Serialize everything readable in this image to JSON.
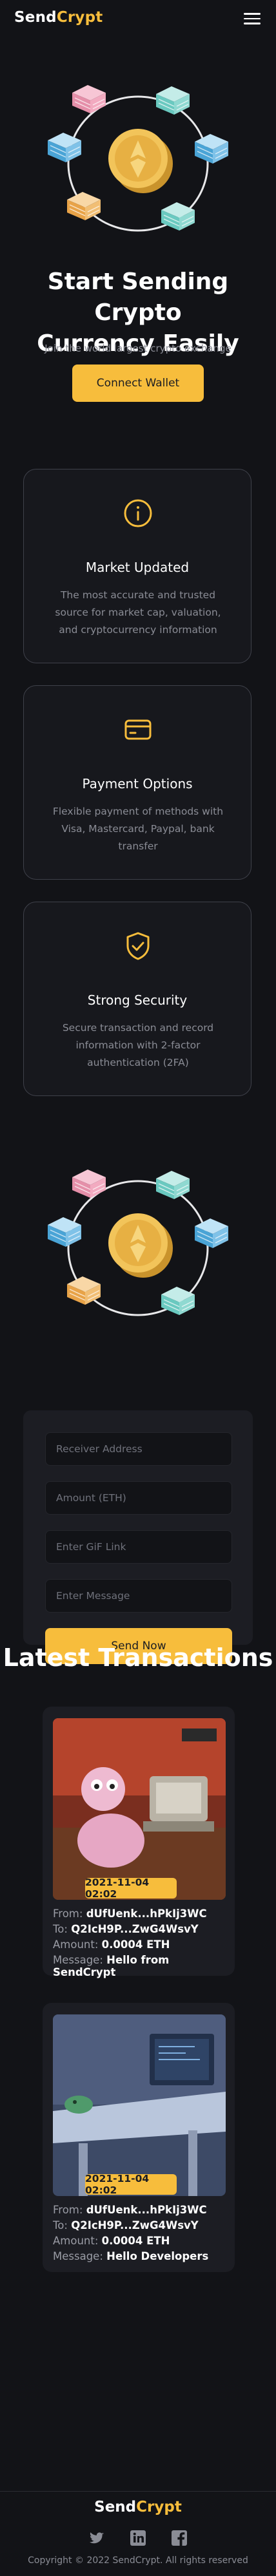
{
  "header": {
    "logo_part1": "Send",
    "logo_part2": "Crypt",
    "menu_icon": "hamburger-menu-icon"
  },
  "hero": {
    "title_line1": "Start Sending Crypto",
    "title_line2": "Currency Easily",
    "subtitle": "Join the world largest crypto exchange",
    "connect_button": "Connect Wallet",
    "illustration": "crypto-coin-network-illustration"
  },
  "features": [
    {
      "icon": "info-circle-icon",
      "title": "Market Updated",
      "description": "The most accurate and trusted source for market cap, valuation, and cryptocurrency information"
    },
    {
      "icon": "credit-card-icon",
      "title": "Payment Options",
      "description": "Flexible payment of methods with Visa, Mastercard, Paypal, bank transfer"
    },
    {
      "icon": "shield-check-icon",
      "title": "Strong Security",
      "description": "Secure transaction and record information with 2-factor authentication (2FA)"
    }
  ],
  "send_form": {
    "receiver_placeholder": "Receiver Address",
    "amount_placeholder": "Amount (ETH)",
    "gif_placeholder": "Enter GiF Link",
    "message_placeholder": "Enter Message",
    "send_button": "Send Now"
  },
  "transactions": {
    "heading": "Latest Transactions",
    "labels": {
      "from": "From:",
      "to": "To:",
      "amount": "Amount:",
      "message": "Message:"
    },
    "items": [
      {
        "date": "2021-11-04 02:02",
        "from": "dUfUenk...hPkIj3WC",
        "to": "Q2IcH9P...ZwG4WsvY",
        "amount": "0.0004 ETH",
        "message": "Hello from SendCrypt",
        "image": "cartoon-dog-computer-gif"
      },
      {
        "date": "2021-11-04 02:02",
        "from": "dUfUenk...hPkIj3WC",
        "to": "Q2IcH9P...ZwG4WsvY",
        "amount": "0.0004 ETH",
        "message": "Hello Developers",
        "image": "animated-desk-computer-gif"
      }
    ]
  },
  "footer": {
    "logo_part1": "Send",
    "logo_part2": "Crypt",
    "social_icons": [
      "twitter-icon",
      "linkedin-icon",
      "facebook-icon"
    ],
    "copyright": "Copyright © 2022 SendCrypt. All rights reserved"
  },
  "colors": {
    "background": "#121317",
    "accent": "#f7bd3c",
    "card_border": "#3f414a",
    "panel": "#1c1d23",
    "muted_text": "#8a8c95"
  }
}
